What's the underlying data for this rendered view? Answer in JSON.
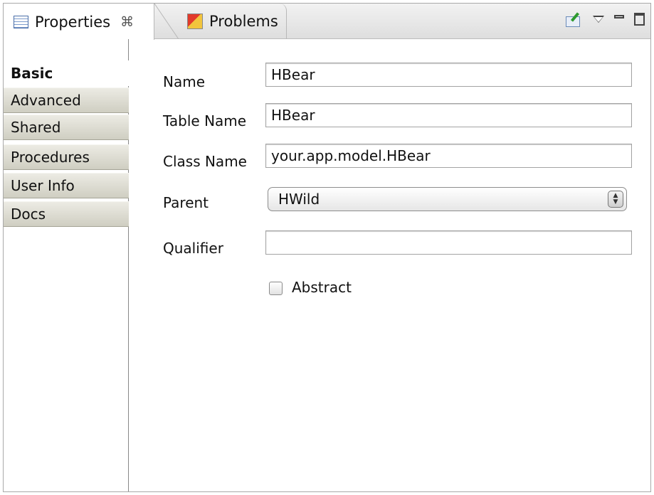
{
  "tabs": [
    {
      "label": "Properties",
      "icon": "properties-icon",
      "active": true
    },
    {
      "label": "Problems",
      "icon": "problems-icon",
      "active": false
    }
  ],
  "toolbar": {
    "icons": [
      "pin-view-icon",
      "view-menu-icon",
      "minimize-icon",
      "maximize-icon"
    ]
  },
  "sections": [
    {
      "label": "Basic",
      "active": true
    },
    {
      "label": "Advanced",
      "active": false
    },
    {
      "label": "Shared",
      "active": false
    },
    {
      "label": "Procedures",
      "active": false
    },
    {
      "label": "User Info",
      "active": false
    },
    {
      "label": "Docs",
      "active": false
    }
  ],
  "form": {
    "name": {
      "label": "Name",
      "value": "HBear"
    },
    "table_name": {
      "label": "Table Name",
      "value": "HBear"
    },
    "class_name": {
      "label": "Class Name",
      "value": "your.app.model.HBear"
    },
    "parent": {
      "label": "Parent",
      "value": "HWild"
    },
    "qualifier": {
      "label": "Qualifier",
      "value": ""
    },
    "abstract": {
      "label": "Abstract",
      "checked": false
    }
  }
}
